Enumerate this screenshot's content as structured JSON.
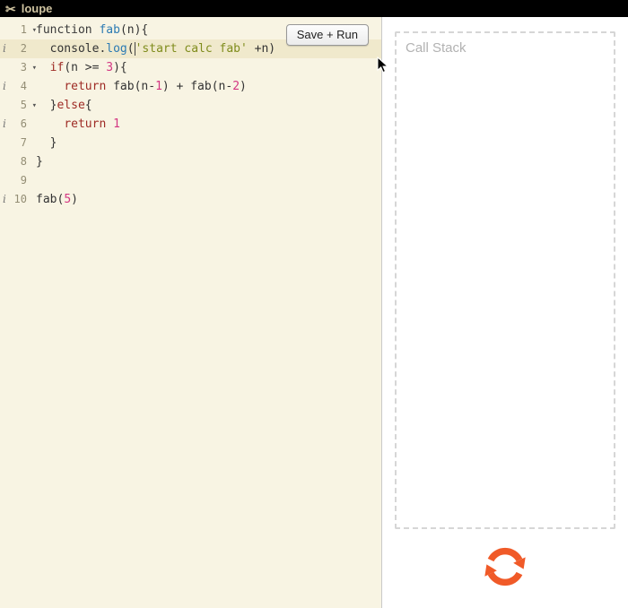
{
  "header": {
    "title": "loupe",
    "logo_glyph": "✂"
  },
  "toolbar": {
    "save_run_label": "Save + Run"
  },
  "editor": {
    "fold_marker": "▾",
    "info_marker": "i",
    "token_colors": {
      "pl": "#333333",
      "kw1": "#3a3a3a",
      "kw2": "#9e2b25",
      "def": "#2b7ab3",
      "str": "#7f8c1c",
      "num": "#d33682"
    },
    "lines": [
      {
        "num": 1,
        "fold": true,
        "info": false,
        "active": false,
        "tokens": [
          {
            "t": "function ",
            "c": "kw1"
          },
          {
            "t": "fab",
            "c": "def"
          },
          {
            "t": "(n){",
            "c": "pl"
          }
        ]
      },
      {
        "num": 2,
        "fold": false,
        "info": true,
        "active": true,
        "tokens": [
          {
            "t": "  console.",
            "c": "pl"
          },
          {
            "t": "log",
            "c": "def"
          },
          {
            "t": "(",
            "c": "pl"
          },
          {
            "t": "",
            "c": "caret"
          },
          {
            "t": "'start calc fab'",
            "c": "str"
          },
          {
            "t": " +n)",
            "c": "pl"
          }
        ]
      },
      {
        "num": 3,
        "fold": true,
        "info": false,
        "active": false,
        "tokens": [
          {
            "t": "  ",
            "c": "pl"
          },
          {
            "t": "if",
            "c": "kw2"
          },
          {
            "t": "(n >= ",
            "c": "pl"
          },
          {
            "t": "3",
            "c": "num"
          },
          {
            "t": "){",
            "c": "pl"
          }
        ]
      },
      {
        "num": 4,
        "fold": false,
        "info": true,
        "active": false,
        "tokens": [
          {
            "t": "    ",
            "c": "pl"
          },
          {
            "t": "return",
            "c": "kw2"
          },
          {
            "t": " fab(n-",
            "c": "pl"
          },
          {
            "t": "1",
            "c": "num"
          },
          {
            "t": ") + fab(n-",
            "c": "pl"
          },
          {
            "t": "2",
            "c": "num"
          },
          {
            "t": ")",
            "c": "pl"
          }
        ]
      },
      {
        "num": 5,
        "fold": true,
        "info": false,
        "active": false,
        "tokens": [
          {
            "t": "  }",
            "c": "pl"
          },
          {
            "t": "else",
            "c": "kw2"
          },
          {
            "t": "{",
            "c": "pl"
          }
        ]
      },
      {
        "num": 6,
        "fold": false,
        "info": true,
        "active": false,
        "tokens": [
          {
            "t": "    ",
            "c": "pl"
          },
          {
            "t": "return",
            "c": "kw2"
          },
          {
            "t": " ",
            "c": "pl"
          },
          {
            "t": "1",
            "c": "num"
          }
        ]
      },
      {
        "num": 7,
        "fold": false,
        "info": false,
        "active": false,
        "tokens": [
          {
            "t": "  }",
            "c": "pl"
          }
        ]
      },
      {
        "num": 8,
        "fold": false,
        "info": false,
        "active": false,
        "tokens": [
          {
            "t": "}",
            "c": "pl"
          }
        ]
      },
      {
        "num": 9,
        "fold": false,
        "info": false,
        "active": false,
        "tokens": []
      },
      {
        "num": 10,
        "fold": false,
        "info": true,
        "active": false,
        "tokens": [
          {
            "t": "fab(",
            "c": "pl"
          },
          {
            "t": "5",
            "c": "num"
          },
          {
            "t": ")",
            "c": "pl"
          }
        ]
      }
    ]
  },
  "right_panel": {
    "call_stack_title": "Call Stack",
    "loop_color": "#f05a28"
  }
}
